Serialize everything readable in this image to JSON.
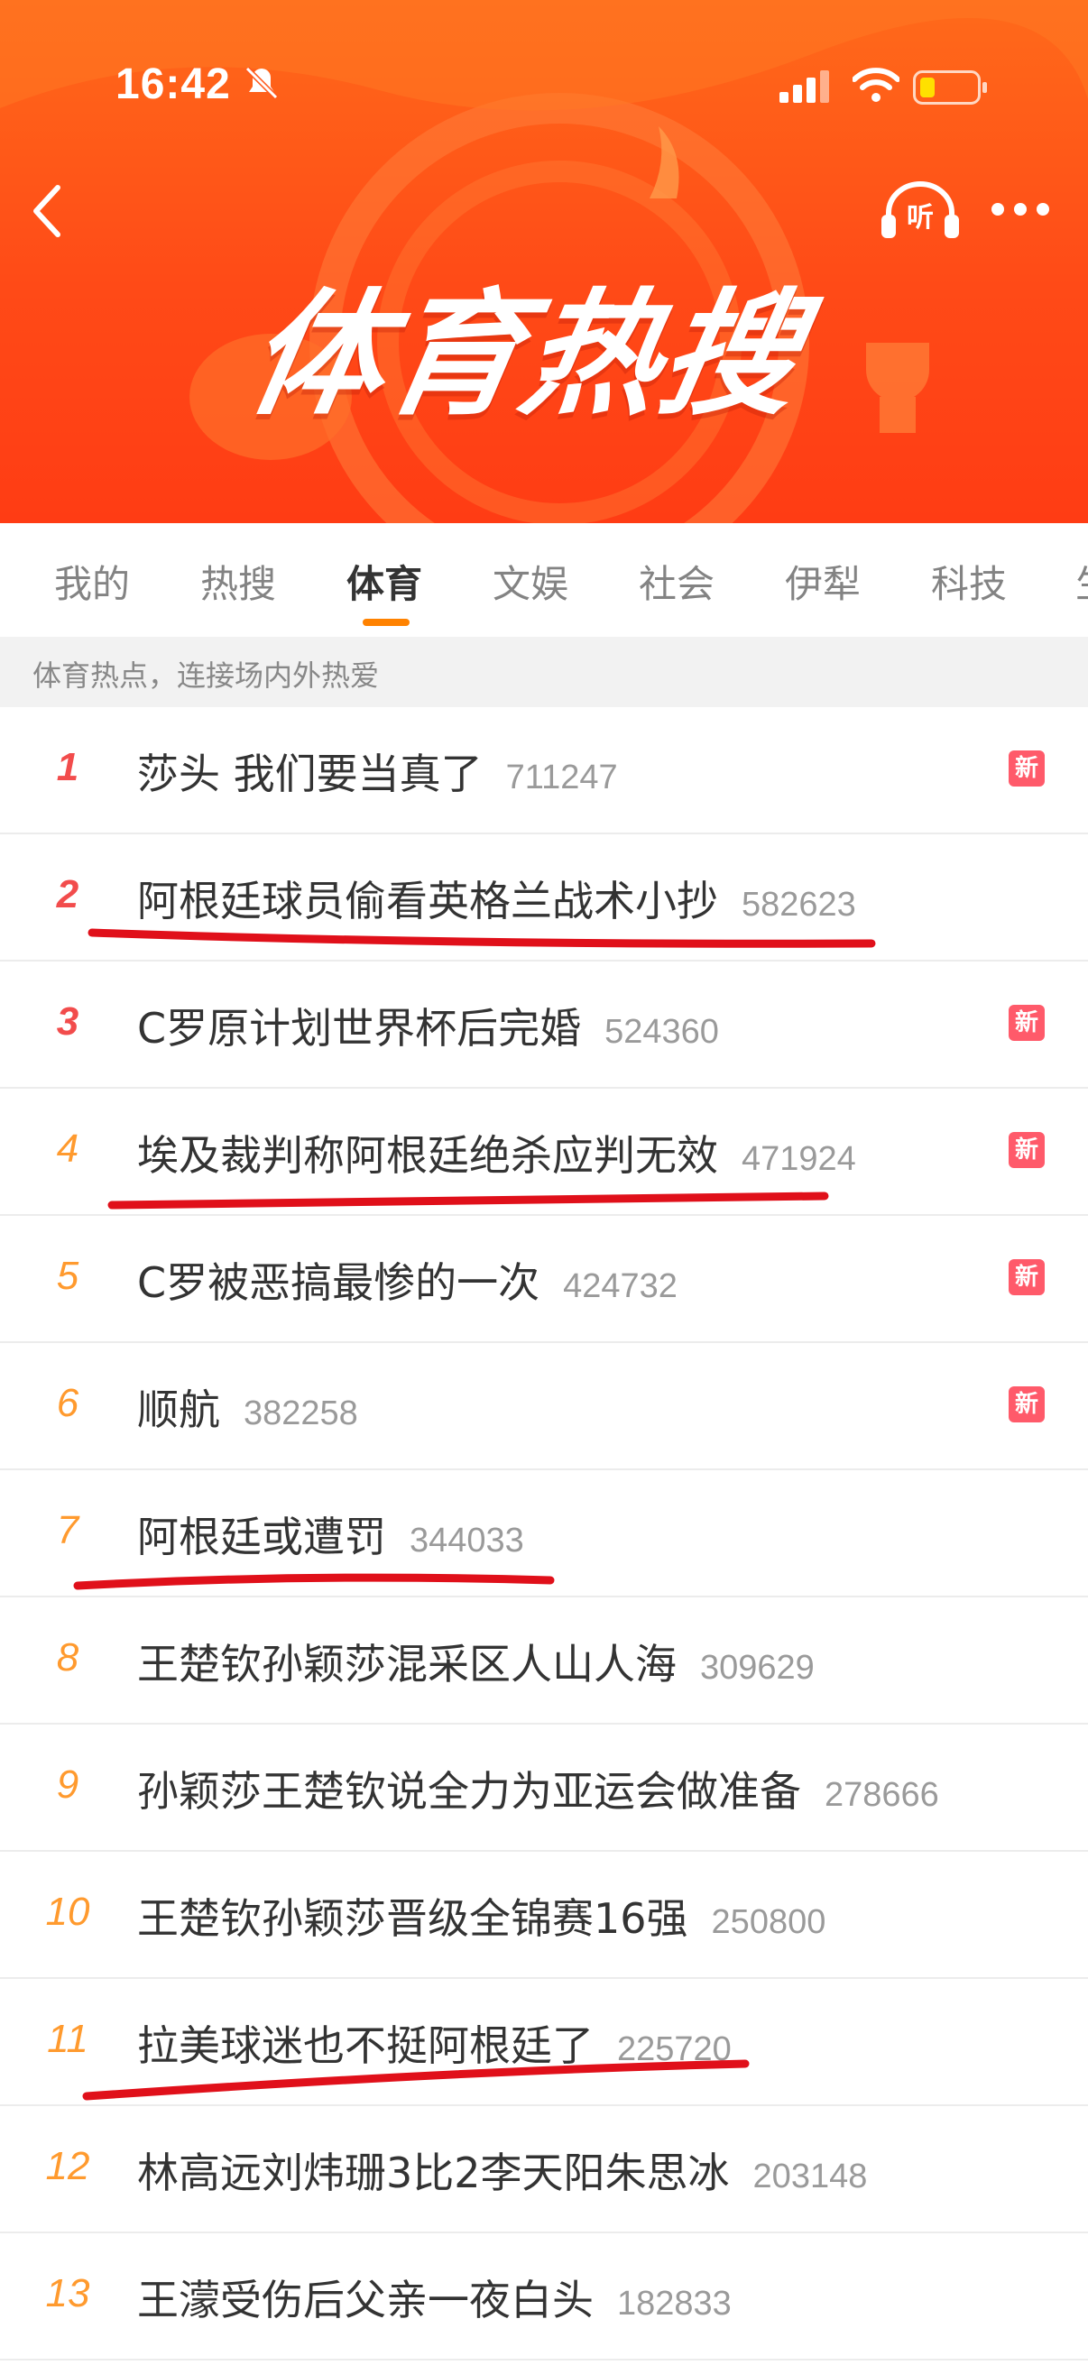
{
  "status_bar": {
    "time": "16:42"
  },
  "banner": {
    "title": "体育热搜",
    "listen_label": "听"
  },
  "tabs": [
    {
      "label": "我的",
      "active": false
    },
    {
      "label": "热搜",
      "active": false
    },
    {
      "label": "体育",
      "active": true
    },
    {
      "label": "文娱",
      "active": false
    },
    {
      "label": "社会",
      "active": false
    },
    {
      "label": "伊犁",
      "active": false
    },
    {
      "label": "科技",
      "active": false
    },
    {
      "label": "生",
      "active": false
    }
  ],
  "subtitle": "体育热点，连接场内外热爱",
  "trending": [
    {
      "rank": "1",
      "title": "莎头 我们要当真了",
      "count": "711247",
      "badge": "新"
    },
    {
      "rank": "2",
      "title": "阿根廷球员偷看英格兰战术小抄",
      "count": "582623",
      "badge": ""
    },
    {
      "rank": "3",
      "title": "C罗原计划世界杯后完婚",
      "count": "524360",
      "badge": "新"
    },
    {
      "rank": "4",
      "title": "埃及裁判称阿根廷绝杀应判无效",
      "count": "471924",
      "badge": "新"
    },
    {
      "rank": "5",
      "title": "C罗被恶搞最惨的一次",
      "count": "424732",
      "badge": "新"
    },
    {
      "rank": "6",
      "title": "顺航",
      "count": "382258",
      "badge": "新"
    },
    {
      "rank": "7",
      "title": "阿根廷或遭罚",
      "count": "344033",
      "badge": ""
    },
    {
      "rank": "8",
      "title": "王楚钦孙颖莎混采区人山人海",
      "count": "309629",
      "badge": ""
    },
    {
      "rank": "9",
      "title": "孙颖莎王楚钦说全力为亚运会做准备",
      "count": "278666",
      "badge": ""
    },
    {
      "rank": "10",
      "title": "王楚钦孙颖莎晋级全锦赛16强",
      "count": "250800",
      "badge": ""
    },
    {
      "rank": "11",
      "title": "拉美球迷也不挺阿根廷了",
      "count": "225720",
      "badge": ""
    },
    {
      "rank": "12",
      "title": "林高远刘炜珊3比2李天阳朱思冰",
      "count": "203148",
      "badge": ""
    },
    {
      "rank": "13",
      "title": "王濛受伤后父亲一夜白头",
      "count": "182833",
      "badge": ""
    }
  ],
  "colors": {
    "banner": "#ff4a17",
    "accent": "#ff8200",
    "rank_top": "#f24c4c",
    "rank_other": "#ff9a2e",
    "new_badge": "#ff5a6a",
    "annotation_line": "#e0101a"
  }
}
